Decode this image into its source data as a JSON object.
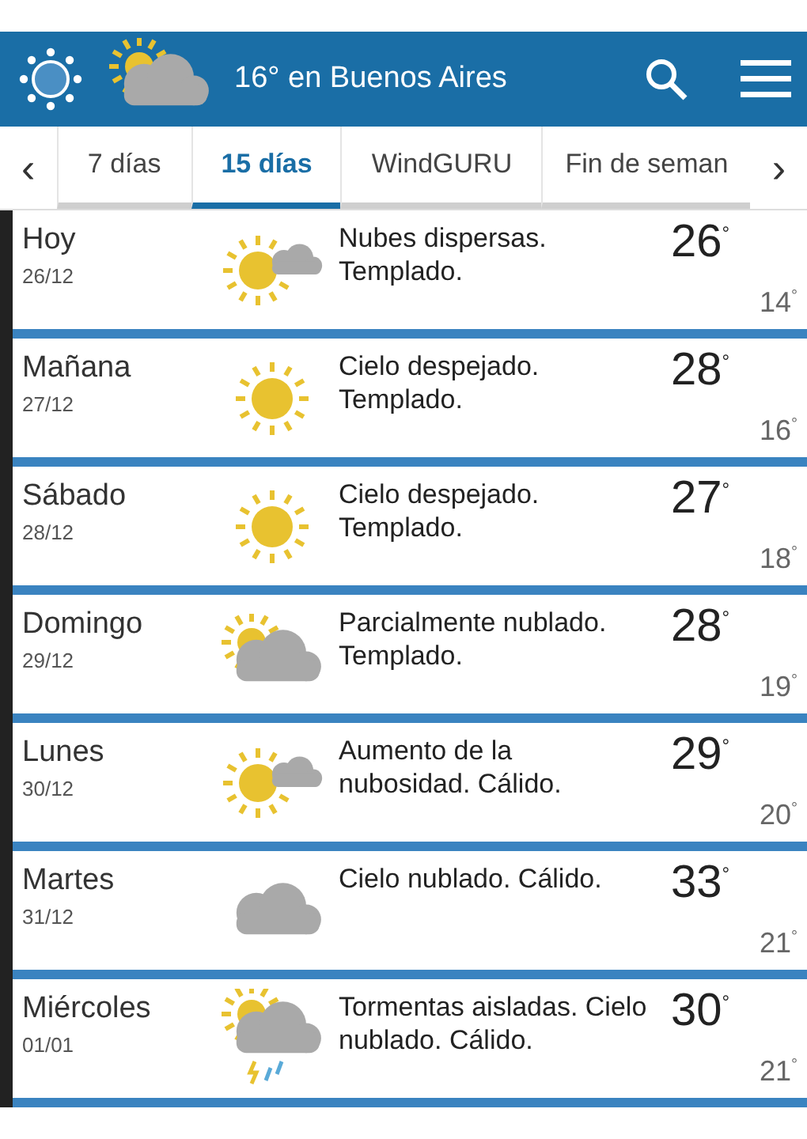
{
  "header": {
    "title": "16° en Buenos Aires"
  },
  "tabs_nav": {
    "prev": "‹",
    "next": "›"
  },
  "tabs": [
    {
      "label": "7 días",
      "selected": false
    },
    {
      "label": "15 días",
      "selected": true
    },
    {
      "label": "WindGURU",
      "selected": false
    },
    {
      "label": "Fin de seman",
      "selected": false
    }
  ],
  "days": [
    {
      "day": "Hoy",
      "date": "26/12",
      "kind": "sun_cloud",
      "description": "Nubes dispersas. Templado.",
      "high": "26$^{°}$",
      "low": "14$^{°}$"
    },
    {
      "day": "Mañana",
      "date": "27/12",
      "kind": "sun",
      "description": "Cielo despejado. Templado.",
      "high": "28$^{°}$",
      "low": "16$^{°}$"
    },
    {
      "day": "Sábado",
      "date": "28/12",
      "kind": "sun",
      "description": "Cielo despejado. Templado.",
      "high": "27$^{°}$",
      "low": "18$^{°}$"
    },
    {
      "day": "Domingo",
      "date": "29/12",
      "kind": "partly_cloudy",
      "description": "Parcialmente nublado. Templado.",
      "high": "28$^{°}$",
      "low": "19$^{°}$"
    },
    {
      "day": "Lunes",
      "date": "30/12",
      "kind": "sun_cloud",
      "description": "Aumento de la nubosidad. Cálido.",
      "high": "29$^{°}$",
      "low": "20$^{°}$"
    },
    {
      "day": "Martes",
      "date": "31/12",
      "kind": "cloud",
      "description": "Cielo nublado. Cálido.",
      "high": "33$^{°}$",
      "low": "21$^{°}$"
    },
    {
      "day": "Miércoles",
      "date": "01/01",
      "kind": "storm",
      "description": "Tormentas aisladas. Cielo nublado. Cálido.",
      "high": "30$^{°}$",
      "low": "21$^{°}$"
    }
  ]
}
